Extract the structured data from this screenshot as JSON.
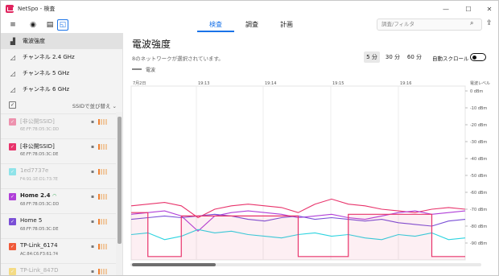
{
  "window": {
    "title": "NetSpo - 検査",
    "minimize_glyph": "—",
    "maximize_glyph": "☐",
    "close_glyph": "✕"
  },
  "toolbar": {
    "menu_glyph": "≡",
    "stop_glyph": "◉",
    "view_list_glyph": "▤",
    "view_chart_glyph": "◱",
    "tabs": [
      {
        "label": "検査",
        "active": true
      },
      {
        "label": "調査",
        "active": false
      },
      {
        "label": "計画",
        "active": false
      }
    ],
    "search_placeholder": "調査/フィルタ",
    "search_icon_glyph": "⌕",
    "share_icon_glyph": "⇪"
  },
  "sidebar": {
    "nav": [
      {
        "label": "電波強度",
        "icon": "signal-bars-icon",
        "glyph": "▟",
        "selected": true
      },
      {
        "label": "チャンネル 2.4 GHz",
        "icon": "channel-chart-icon",
        "glyph": "◿",
        "selected": false
      },
      {
        "label": "チャンネル 5 GHz",
        "icon": "channel-chart-icon",
        "glyph": "◿",
        "selected": false
      },
      {
        "label": "チャンネル 6 GHz",
        "icon": "channel-chart-icon",
        "glyph": "◿",
        "selected": false
      }
    ],
    "sort_check_glyph": "✓",
    "sort_label": "SSIDで並び替え ⌄",
    "networks": [
      {
        "ssid": "[非公開SSID]",
        "mac": "6E:FF:7B:D5:3C:DD",
        "color": "#e8336b",
        "dim": true,
        "bold": false,
        "wifi": false,
        "bars": 1
      },
      {
        "ssid": "[非公開SSID]",
        "mac": "6E:FF:7B:D5:3C:DE",
        "color": "#e8336b",
        "dim": false,
        "bold": false,
        "wifi": false,
        "bars": 1
      },
      {
        "ssid": "1ed7737e",
        "mac": "F4:91:1E:D1:73:7E",
        "color": "#2dd4e0",
        "dim": true,
        "bold": false,
        "wifi": false,
        "bars": 1
      },
      {
        "ssid": "Home 2.4",
        "mac": "68:FF:7B:D5:3C:DD",
        "color": "#b03fd8",
        "dim": false,
        "bold": true,
        "wifi": true,
        "bars": 1
      },
      {
        "ssid": "Home 5",
        "mac": "68:FF:7B:D5:3C:DE",
        "color": "#7a4fd6",
        "dim": false,
        "bold": false,
        "wifi": false,
        "bars": 1
      },
      {
        "ssid": "TP-Link_6174",
        "mac": "AC:84:C6:F3:61:74",
        "color": "#f05a3a",
        "dim": false,
        "bold": false,
        "wifi": false,
        "bars": 1
      },
      {
        "ssid": "TP-Link_847D",
        "mac": "",
        "color": "#f5c518",
        "dim": true,
        "bold": false,
        "wifi": false,
        "bars": 1
      }
    ],
    "lock_glyph": "🔒",
    "check_glyph": "✓",
    "wifi_glyph": "◠"
  },
  "main": {
    "title": "電波強度",
    "subtitle": "8のネットワークが選択されています。",
    "time_buttons": [
      {
        "label": "5 分",
        "selected": true
      },
      {
        "label": "30 分",
        "selected": false
      },
      {
        "label": "60 分",
        "selected": false
      }
    ],
    "autoscroll_label": "自動スクロール",
    "autoscroll_on": false,
    "legend_label": "電波"
  },
  "chart_data": {
    "type": "line",
    "x_ticks": [
      "7月2日",
      "19:13",
      "19:14",
      "19:15",
      "19:16"
    ],
    "y_axis_title": "電波レベル",
    "y_ticks": [
      "0 dBm",
      "-10 dBm",
      "-20 dBm",
      "-30 dBm",
      "-40 dBm",
      "-50 dBm",
      "-60 dBm",
      "-70 dBm",
      "-80 dBm",
      "-90 dBm"
    ],
    "ylim": [
      -100,
      0
    ],
    "grid": true,
    "series": [
      {
        "color": "#e8336b",
        "values": [
          -68,
          -67,
          -66,
          -68,
          -75,
          -70,
          -68,
          -67,
          -68,
          -69,
          -72,
          -67,
          -64,
          -67,
          -68,
          -70,
          -71,
          -72,
          -70,
          -69,
          -70
        ]
      },
      {
        "color": "#b03fd8",
        "values": [
          -73,
          -72,
          -71,
          -74,
          -83,
          -74,
          -72,
          -71,
          -72,
          -73,
          -75,
          -74,
          -73,
          -75,
          -76,
          -74,
          -72,
          -71,
          -73,
          -72,
          -71
        ]
      },
      {
        "color": "#7a4fd6",
        "values": [
          -76,
          -75,
          -74,
          -75,
          -74,
          -73,
          -74,
          -76,
          -77,
          -75,
          -74,
          -76,
          -75,
          -76,
          -77,
          -76,
          -78,
          -79,
          -80,
          -77,
          -76
        ]
      },
      {
        "color": "#2dd4e0",
        "values": [
          -85,
          -84,
          -88,
          -86,
          -82,
          -84,
          -83,
          -85,
          -86,
          -87,
          -85,
          -84,
          -86,
          -85,
          -87,
          -88,
          -85,
          -86,
          -84,
          -88,
          -87
        ]
      },
      {
        "color": "#e8336b",
        "fill": true,
        "values": [
          -72,
          -98,
          -98,
          -74,
          -74,
          -74,
          -74,
          -74,
          -74,
          -74,
          -98,
          -98,
          -98,
          -73,
          -73,
          -73,
          -73,
          -73,
          -98,
          -98,
          -98
        ]
      }
    ]
  }
}
